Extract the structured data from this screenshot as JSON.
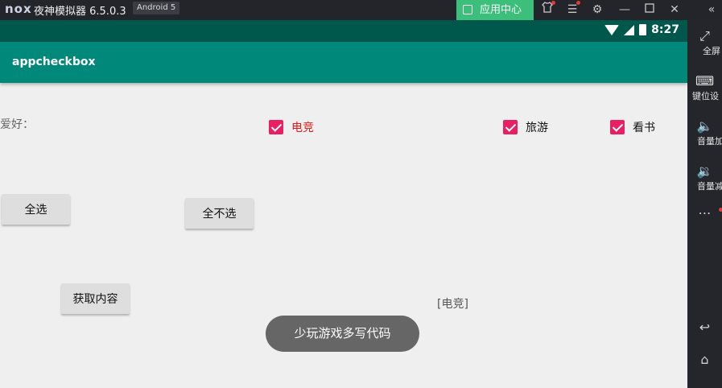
{
  "emulator": {
    "logo": "nox",
    "title": "夜神模拟器 6.5.0.3",
    "android_badge": "Android 5",
    "app_center": "应用中心",
    "sidebar": [
      {
        "icon": "fullscreen-icon",
        "label": "全屏"
      },
      {
        "icon": "keyboard-icon",
        "label": "键位设"
      },
      {
        "icon": "volume-up-icon",
        "label": "音量加"
      },
      {
        "icon": "volume-down-icon",
        "label": "音量减"
      }
    ]
  },
  "status_bar": {
    "time": "8:27"
  },
  "app": {
    "title": "appcheckbox",
    "hobby_label": "爱好：",
    "checkboxes": [
      {
        "label": "电竞",
        "checked": true,
        "color": "#e31919"
      },
      {
        "label": "旅游",
        "checked": true
      },
      {
        "label": "看书",
        "checked": true
      }
    ],
    "accent_color": "#e91e63",
    "buttons": {
      "select_all": "全选",
      "select_none": "全不选",
      "get_content": "获取内容"
    },
    "result_text": "[电竞]",
    "toast": "少玩游戏多写代码"
  }
}
